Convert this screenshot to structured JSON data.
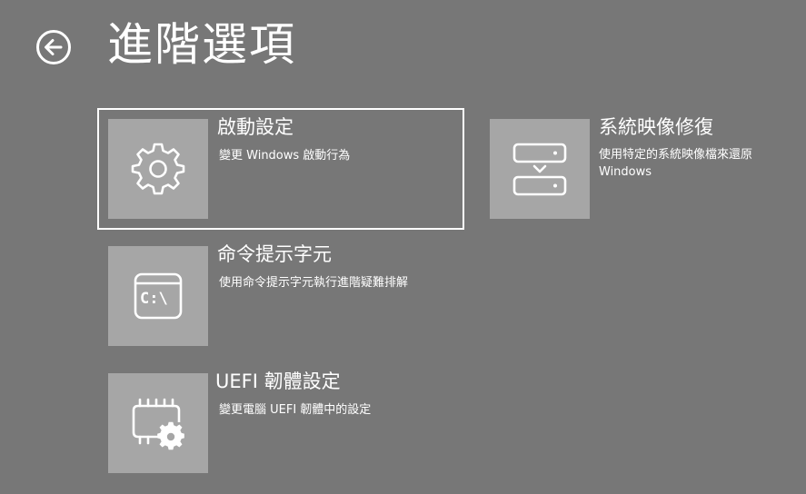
{
  "header": {
    "title": "進階選項",
    "back_icon": "arrow-left-circle-icon"
  },
  "options": [
    {
      "title": "啟動設定",
      "description": "變更 Windows 啟動行為",
      "icon": "gear-icon",
      "selected": true
    },
    {
      "title": "系統映像修復",
      "description_line1": "使用特定的系統映像檔來還原",
      "description_line2": "Windows",
      "icon": "system-image-icon",
      "selected": false
    },
    {
      "title": "命令提示字元",
      "description": "使用命令提示字元執行進階疑難排解",
      "icon": "command-prompt-icon",
      "icon_text": "C:\\",
      "selected": false
    },
    {
      "title": "UEFI 韌體設定",
      "description": "變更電腦 UEFI 韌體中的設定",
      "icon": "chip-gear-icon",
      "selected": false
    }
  ],
  "colors": {
    "background": "#777777",
    "tile": "#a6a6a6",
    "text": "#ffffff",
    "selection_border": "#ffffff"
  }
}
